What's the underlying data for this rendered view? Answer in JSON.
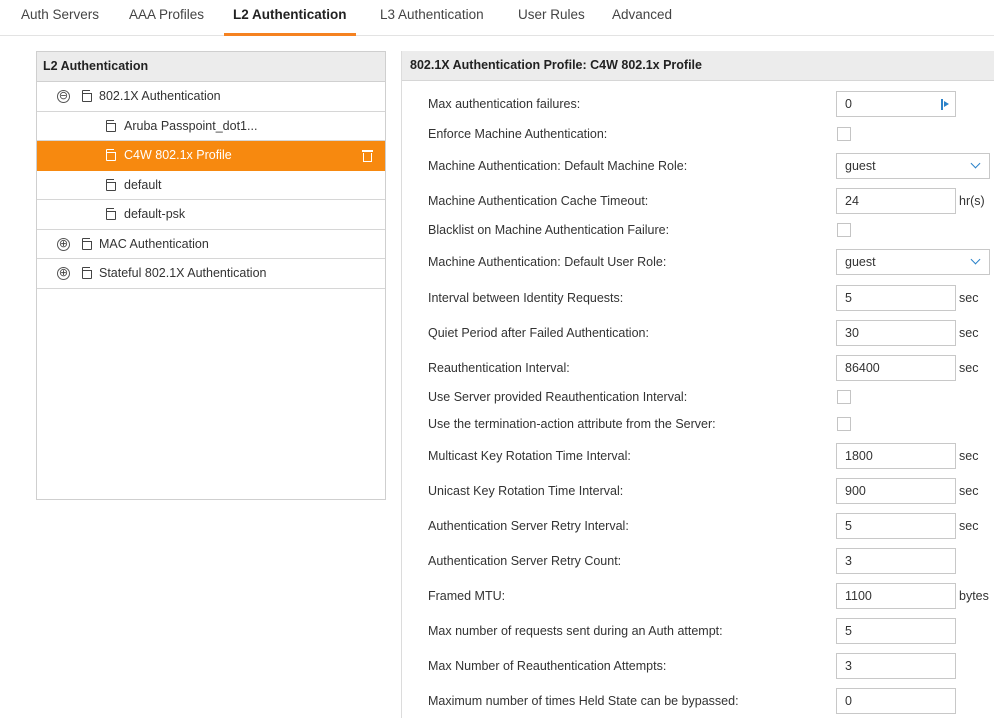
{
  "tabs": [
    {
      "label": "Auth Servers"
    },
    {
      "label": "AAA Profiles"
    },
    {
      "label": "L2 Authentication"
    },
    {
      "label": "L3 Authentication"
    },
    {
      "label": "User Rules"
    },
    {
      "label": "Advanced"
    }
  ],
  "active_tab": "L2 Authentication",
  "accent_color": "#f7890f",
  "link_color": "#2b82c9",
  "left_panel": {
    "title": "L2 Authentication",
    "tree": [
      {
        "label": "802.1X Authentication",
        "expander": "⊖",
        "expanded": true
      },
      {
        "label": "Aruba Passpoint_dot1..."
      },
      {
        "label": "C4W 802.1x Profile",
        "selected": true
      },
      {
        "label": "default"
      },
      {
        "label": "default-psk"
      },
      {
        "label": "MAC Authentication",
        "expander": "⊕",
        "expanded": false
      },
      {
        "label": "Stateful 802.1X Authentication",
        "expander": "⊕",
        "expanded": false
      }
    ]
  },
  "right_panel": {
    "title": "802.1X Authentication Profile: C4W 802.1x Profile",
    "fields": [
      {
        "label": "Max authentication failures:",
        "type": "spinner",
        "value": "0"
      },
      {
        "label": "Enforce Machine Authentication:",
        "type": "checkbox",
        "checked": false
      },
      {
        "label": "Machine Authentication: Default Machine Role:",
        "type": "select",
        "value": "guest"
      },
      {
        "label": "Machine Authentication Cache Timeout:",
        "type": "text",
        "value": "24",
        "unit": "hr(s)"
      },
      {
        "label": "Blacklist on Machine Authentication Failure:",
        "type": "checkbox",
        "checked": false
      },
      {
        "label": "Machine Authentication: Default User Role:",
        "type": "select",
        "value": "guest"
      },
      {
        "label": "Interval between Identity Requests:",
        "type": "text",
        "value": "5",
        "unit": "sec"
      },
      {
        "label": "Quiet Period after Failed Authentication:",
        "type": "text",
        "value": "30",
        "unit": "sec"
      },
      {
        "label": "Reauthentication Interval:",
        "type": "text",
        "value": "86400",
        "unit": "sec"
      },
      {
        "label": "Use Server provided Reauthentication Interval:",
        "type": "checkbox",
        "checked": false
      },
      {
        "label": "Use the termination-action attribute from the Server:",
        "type": "checkbox",
        "checked": false
      },
      {
        "label": "Multicast Key Rotation Time Interval:",
        "type": "text",
        "value": "1800",
        "unit": "sec"
      },
      {
        "label": "Unicast Key Rotation Time Interval:",
        "type": "text",
        "value": "900",
        "unit": "sec"
      },
      {
        "label": "Authentication Server Retry Interval:",
        "type": "text",
        "value": "5",
        "unit": "sec"
      },
      {
        "label": "Authentication Server Retry Count:",
        "type": "text",
        "value": "3"
      },
      {
        "label": "Framed MTU:",
        "type": "text",
        "value": "1100",
        "unit": "bytes"
      },
      {
        "label": "Max number of requests sent during an Auth attempt:",
        "type": "text",
        "value": "5"
      },
      {
        "label": "Max Number of Reauthentication Attempts:",
        "type": "text",
        "value": "3"
      },
      {
        "label": "Maximum number of times Held State can be bypassed:",
        "type": "text",
        "value": "0"
      }
    ]
  }
}
